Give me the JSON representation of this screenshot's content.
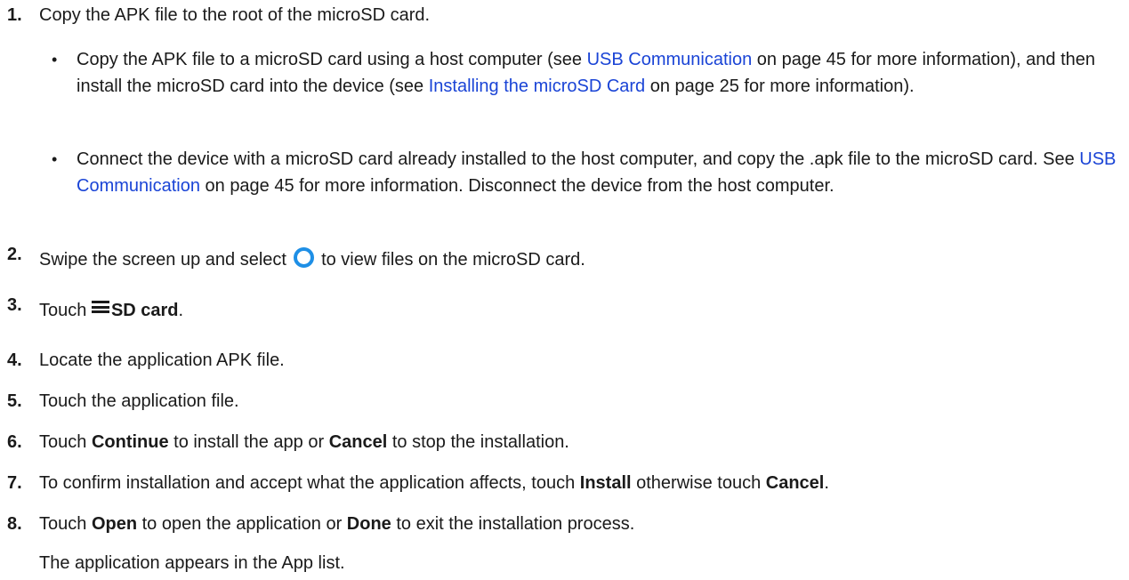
{
  "steps": [
    {
      "number": "1.",
      "text": "Copy the APK file to the root of the microSD card.",
      "bullets": [
        {
          "parts": [
            {
              "t": "Copy the APK file to a microSD card using a host computer (see "
            },
            {
              "link": "USB Communication"
            },
            {
              "t": " on page 45 for more information), and then install the microSD card into the device (see "
            },
            {
              "link": "Installing the microSD Card"
            },
            {
              "t": " on page 25 for more information)."
            }
          ]
        },
        {
          "parts": [
            {
              "t": "Connect the device with a microSD card already installed to the host computer, and copy the .apk file to the microSD card. See "
            },
            {
              "link": "USB Communication"
            },
            {
              "t": " on page 45 for more information. Disconnect the device from the host computer."
            }
          ]
        }
      ]
    },
    {
      "number": "2.",
      "before_icon": "Swipe the screen up and select ",
      "icon": "files-app-circle-icon",
      "after_icon": " to view files on the microSD card."
    },
    {
      "number": "3.",
      "before_icon": "Touch ",
      "icon": "menu-icon",
      "bold": "SD card",
      "after": "."
    },
    {
      "number": "4.",
      "text": "Locate the application APK file."
    },
    {
      "number": "5.",
      "text": "Touch the application file."
    },
    {
      "number": "6.",
      "parts": [
        {
          "t": "Touch "
        },
        {
          "b": "Continue"
        },
        {
          "t": " to install the app or "
        },
        {
          "b": "Cancel"
        },
        {
          "t": " to stop the installation."
        }
      ]
    },
    {
      "number": "7.",
      "parts": [
        {
          "t": "To confirm installation and accept what the application affects, touch "
        },
        {
          "b": "Install"
        },
        {
          "t": " otherwise touch "
        },
        {
          "b": "Cancel"
        },
        {
          "t": "."
        }
      ]
    },
    {
      "number": "8.",
      "parts": [
        {
          "t": "Touch "
        },
        {
          "b": "Open"
        },
        {
          "t": " to open the application or "
        },
        {
          "b": "Done"
        },
        {
          "t": " to exit the installation process."
        }
      ]
    }
  ],
  "result_note": "The application appears in the App list.",
  "colors": {
    "link": "#1a44d6",
    "icon_blue": "#1e8fe6",
    "text": "#1a1a1a"
  }
}
